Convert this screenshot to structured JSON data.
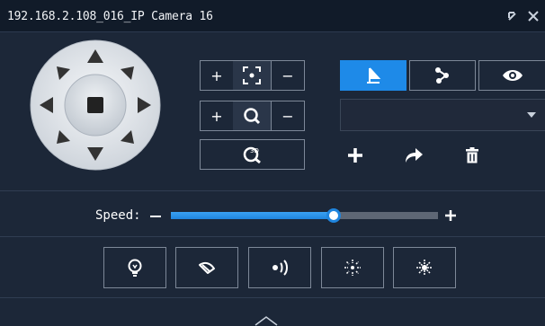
{
  "window": {
    "title": "192.168.2.108_016_IP Camera 16"
  },
  "ptz": {
    "zoom": {
      "plus": "+",
      "minus": "−"
    },
    "focus": {
      "plus": "+",
      "minus": "−"
    },
    "three_d_label": "3D"
  },
  "preset_tabs": [
    {
      "name": "preset",
      "active": true
    },
    {
      "name": "patrol",
      "active": false
    },
    {
      "name": "view",
      "active": false
    }
  ],
  "preset_select": {
    "value": ""
  },
  "speed": {
    "label": "Speed:",
    "minus": "−",
    "plus": "+",
    "level_fraction": 0.61
  },
  "aux_buttons": [
    "light-icon",
    "wiper-icon",
    "auto-scan-icon",
    "ir-light-icon",
    "defog-icon"
  ],
  "colors": {
    "accent": "#1e8ae8",
    "background": "#1c2738",
    "titlebar": "#111b29"
  }
}
